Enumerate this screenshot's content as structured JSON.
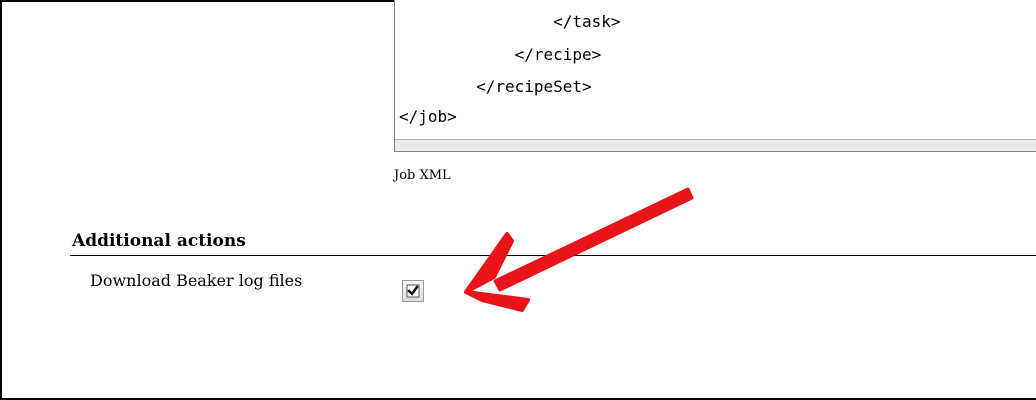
{
  "job_xml": {
    "lines": [
      "                </task>",
      "            </recipe>",
      "        </recipeSet>",
      "</job>"
    ],
    "label": "Job XML"
  },
  "additional_actions": {
    "heading": "Additional actions",
    "download_logs_label": "Download Beaker log files",
    "download_logs_checked": true
  },
  "colors": {
    "annotation_arrow": "#e8141a"
  }
}
